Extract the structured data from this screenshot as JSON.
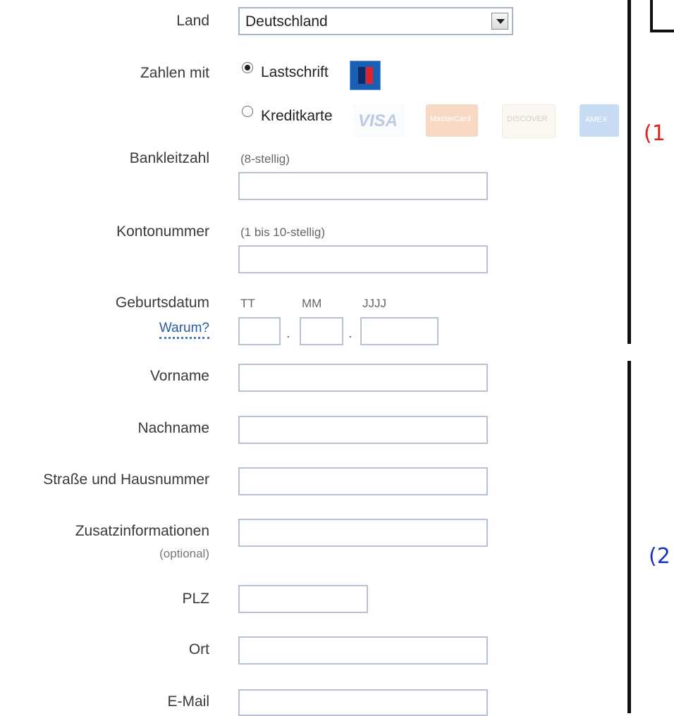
{
  "country": {
    "label": "Land",
    "selected": "Deutschland"
  },
  "payment": {
    "label": "Zahlen mit",
    "options": [
      {
        "label": "Lastschrift",
        "selected": true
      },
      {
        "label": "Kreditkarte",
        "selected": false
      }
    ],
    "card_logos": [
      "VISA",
      "MasterCard",
      "DISCOVER",
      "AMEX"
    ]
  },
  "bank_code": {
    "label": "Bankleitzahl",
    "hint": "(8-stellig)",
    "value": ""
  },
  "account_number": {
    "label": "Kontonummer",
    "hint": "(1 bis 10-stellig)",
    "value": ""
  },
  "birthdate": {
    "label": "Geburtsdatum",
    "why_link": "Warum?",
    "day_label": "TT",
    "month_label": "MM",
    "year_label": "JJJJ",
    "separator": "."
  },
  "first_name": {
    "label": "Vorname",
    "value": ""
  },
  "last_name": {
    "label": "Nachname",
    "value": ""
  },
  "street": {
    "label": "Straße und Hausnummer",
    "value": ""
  },
  "additional": {
    "label": "Zusatzinformationen",
    "optional": "(optional)",
    "value": ""
  },
  "zip": {
    "label": "PLZ",
    "value": ""
  },
  "city": {
    "label": "Ort",
    "value": ""
  },
  "email": {
    "label": "E-Mail",
    "value": ""
  },
  "annotations": {
    "one": "(1",
    "two": "(2"
  },
  "colors": {
    "ec_blue": "#1b5fb5",
    "ec_red": "#e2232a",
    "annotation_red": "#e02020",
    "annotation_blue": "#1a33c8"
  }
}
